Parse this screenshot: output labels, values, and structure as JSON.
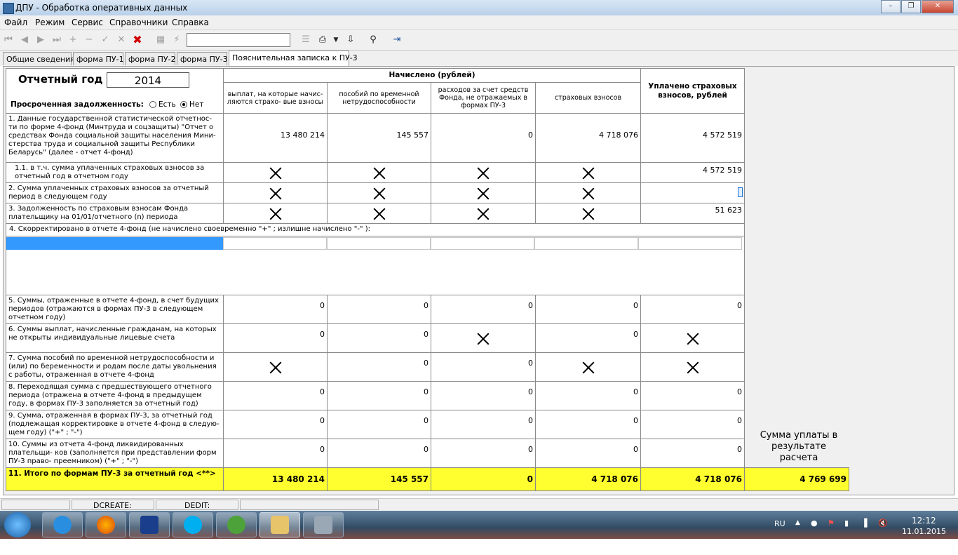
{
  "window": {
    "title": "ДПУ - Обработка оперативных данных"
  },
  "menu": [
    "Файл",
    "Режим",
    "Сервис",
    "Справочники",
    "Справка"
  ],
  "tabs": [
    "Общие сведения",
    "форма ПУ-1",
    "форма ПУ-2",
    "форма ПУ-3",
    "Пояснительная записка к ПУ-3"
  ],
  "form": {
    "year_label": "Отчетный год",
    "year_value": "2014",
    "overdue_label": "Просроченная задолженность:",
    "opt_yes": "Есть",
    "opt_no": "Нет",
    "accrued_header": "Начислено (рублей)",
    "col_payments": "выплат, на которые начис- ляются страхо- вые взносы",
    "col_benefits": "пособий по временной нетрудоспособности",
    "col_expenses": "расходов за счет средств Фонда, не отражаемых в формах ПУ-3",
    "col_contrib": "страховых взносов",
    "col_paid": "Уплачено страховых взносов, рублей"
  },
  "rows": {
    "r1": {
      "label": "1. Данные государственной статистической отчетнос- ти по форме 4-фонд (Минтруда и соцзащиты) \"Отчет о средствах Фонда социальной защиты населения Мини- стерства труда и социальной защиты Республики Беларусь\" (далее - отчет 4-фонд)",
      "c1": "13 480 214",
      "c2": "145 557",
      "c3": "0",
      "c4": "4 718 076",
      "c5": "4 572 519"
    },
    "r11": {
      "label": "1.1. в т.ч. сумма уплаченных страховых взносов за отчетный год в отчетном году",
      "c5": "4 572 519"
    },
    "r2": {
      "label": "2. Сумма уплаченных страховых взносов за отчетный период в следующем году"
    },
    "r3": {
      "label": "3. Задолженность по страховым взносам Фонда плательщику на 01/01/отчетного (n) периода",
      "c5": "51 623"
    },
    "r4": {
      "label": "4. Скорректировано в отчете 4-фонд  (не начислено своевременно \"+\" ; излишне начислено \"-\" ):"
    },
    "r5": {
      "label": "5. Суммы, отраженные в отчете 4-фонд, в счет будущих периодов (отражаются в формах ПУ-3 в следующем отчетном году)",
      "c1": "0",
      "c2": "0",
      "c3": "0",
      "c4": "0",
      "c5": "0"
    },
    "r6": {
      "label": "6. Суммы выплат, начисленные гражданам, на которых не открыты индивидуальные лицевые счета",
      "c1": "0",
      "c2": "0",
      "c4": "0"
    },
    "r7": {
      "label": "7. Сумма пособий по временной нетрудоспособности и (или) по беременности и родам после даты увольнения с работы, отраженная в отчете  4-фонд",
      "c2": "0",
      "c3": "0"
    },
    "r8": {
      "label": "8. Переходящая сумма с предшествующего отчетного периода (отражена в отчете 4-фонд в предыдущем году, в формах ПУ-3 заполняется за отчетный год)",
      "c1": "0",
      "c2": "0",
      "c3": "0",
      "c4": "0",
      "c5": "0"
    },
    "r9": {
      "label": "9. Сумма, отраженная в формах ПУ-3, за отчетный год (подлежащая корректировке в отчете 4-фонд в следую- щем году) (\"+\" ; \"-\")",
      "c1": "0",
      "c2": "0",
      "c3": "0",
      "c4": "0",
      "c5": "0"
    },
    "r10": {
      "label": "10. Суммы из отчета 4-фонд  ликвидированных плательщи- ков (заполняется при представлении форм ПУ-3 право- преемником) (\"+\" ; \"-\")",
      "c1": "0",
      "c2": "0",
      "c3": "0",
      "c4": "0",
      "c5": "0"
    },
    "total": {
      "label": "11. Итого по формам ПУ-3 за отчетный год  <**>",
      "c1": "13 480 214",
      "c2": "145 557",
      "c3": "0",
      "c4": "4 718 076",
      "c5": "4 718 076",
      "c6": "4 769 699"
    }
  },
  "result_label": "Сумма уплаты в результате расчета",
  "status": {
    "dcreate": "DCREATE:",
    "dedit": "DEDIT:"
  },
  "tray": {
    "lang": "RU",
    "time": "12:12",
    "date": "11.01.2015"
  },
  "colors": {
    "total_bg": "#ffff30",
    "selection": "#3399ff"
  }
}
